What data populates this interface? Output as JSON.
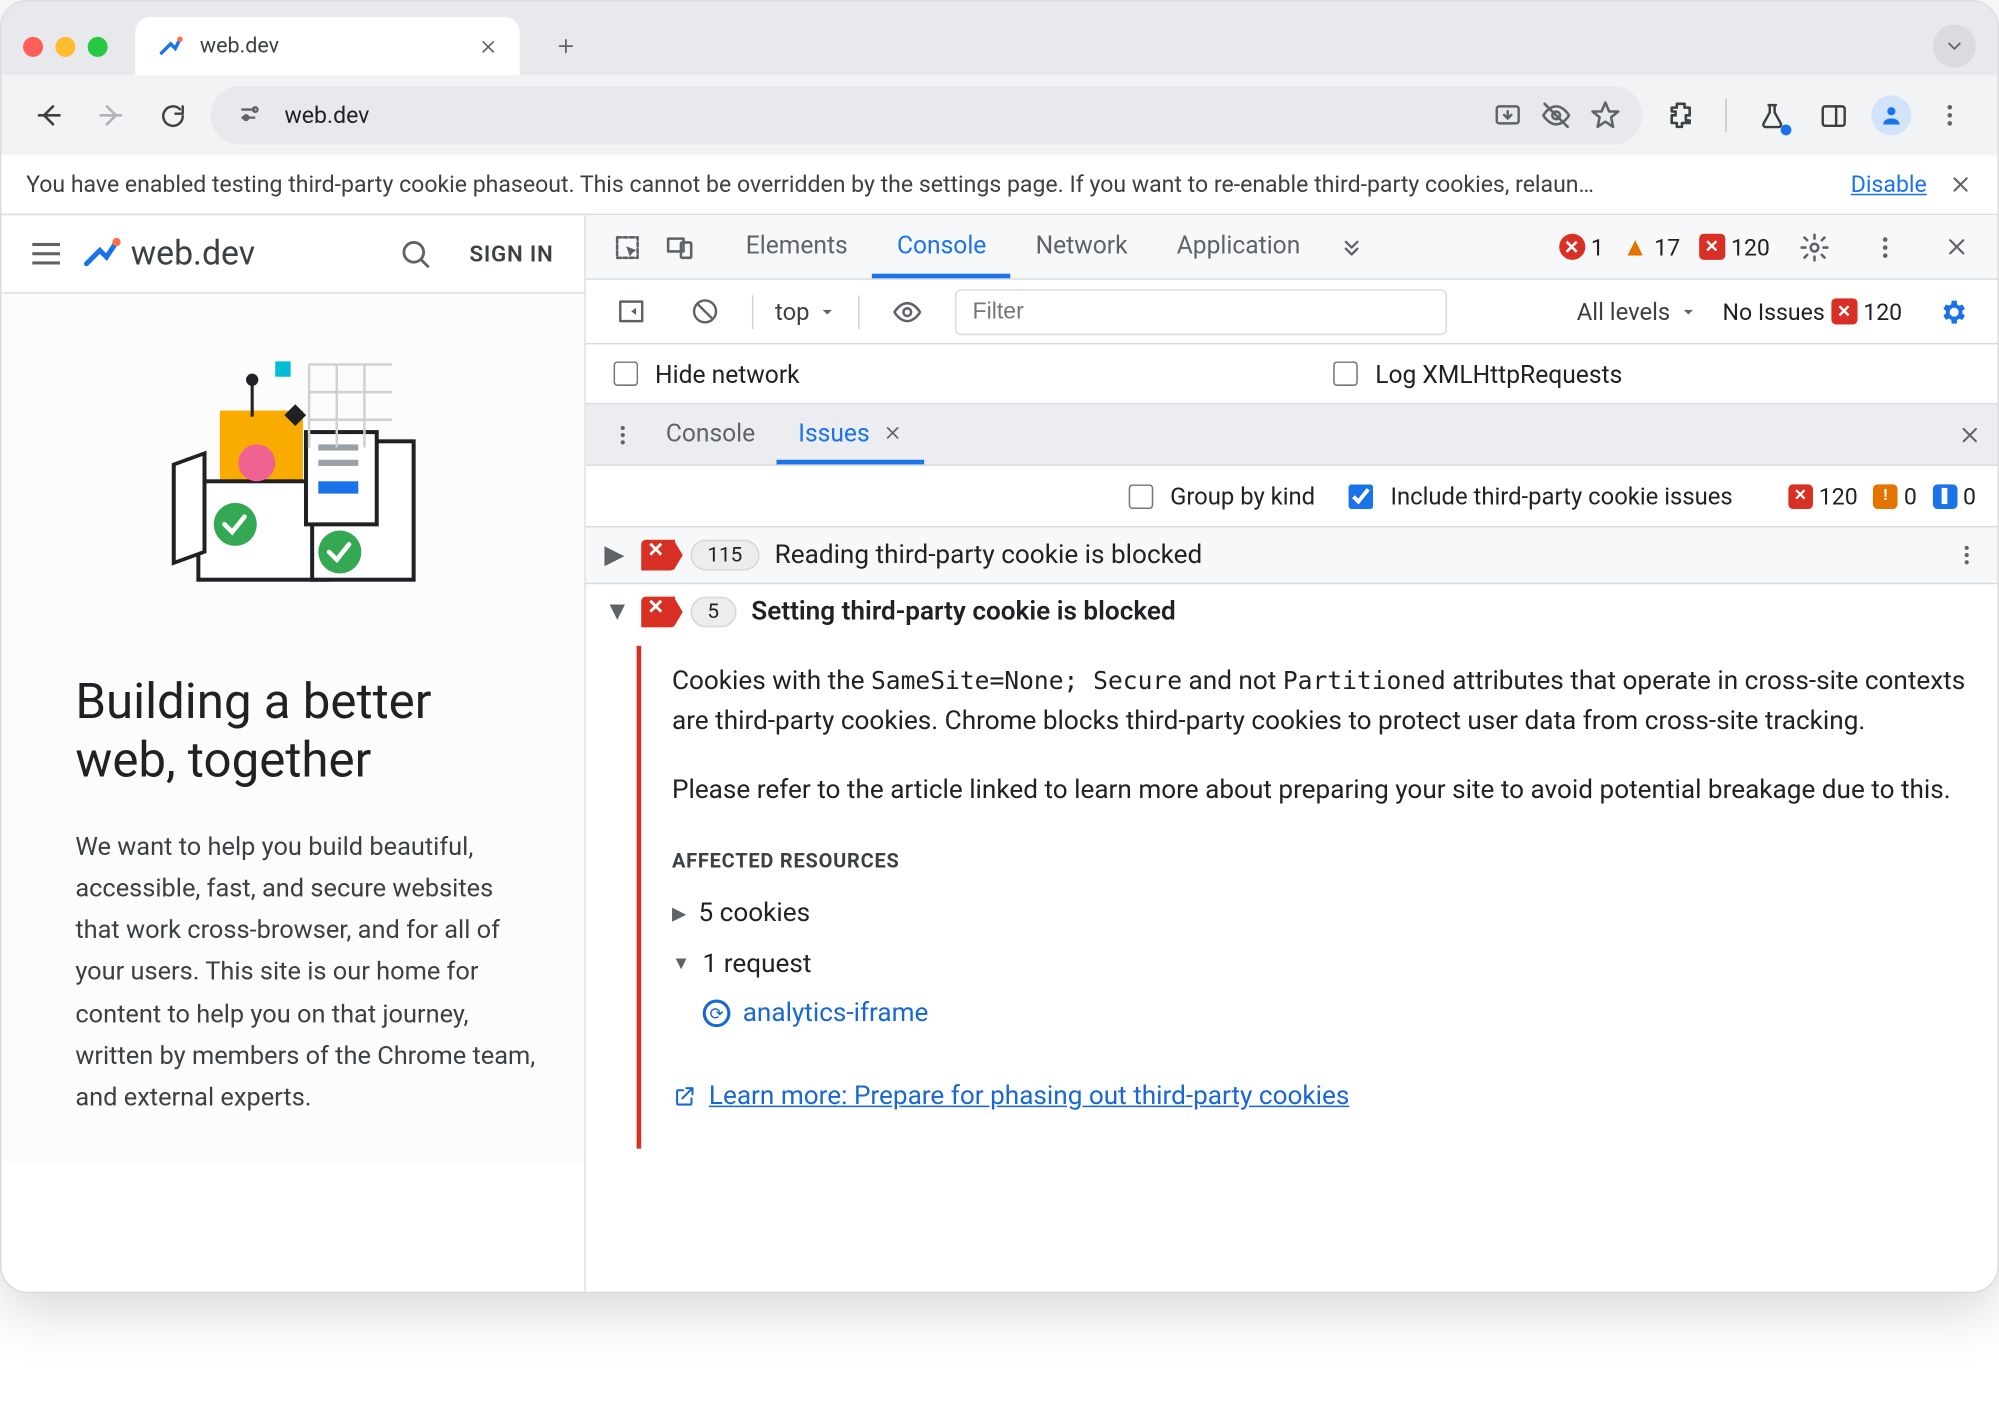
{
  "browser_tab": {
    "title": "web.dev"
  },
  "omnibox": {
    "url": "web.dev"
  },
  "banner": {
    "text": "You have enabled testing third-party cookie phaseout. This cannot be overridden by the settings page. If you want to re-enable third-party cookies, relaun…",
    "action": "Disable"
  },
  "page": {
    "brand": "web.dev",
    "sign_in": "SIGN IN",
    "hero_title": "Building a better web, together",
    "hero_body": "We want to help you build beautiful, accessible, fast, and secure websites that work cross-browser, and for all of your users. This site is our home for content to help you on that journey, written by members of the Chrome team, and external experts."
  },
  "devtools": {
    "tabs": {
      "elements": "Elements",
      "console": "Console",
      "network": "Network",
      "application": "Application"
    },
    "counts": {
      "errors": 1,
      "warnings": 17,
      "blocked": 120
    },
    "filter": {
      "context": "top",
      "placeholder": "Filter",
      "levels": "All levels",
      "issues": "No Issues",
      "issues_count": 120
    },
    "checks": {
      "hide_network": "Hide network",
      "log_xhr": "Log XMLHttpRequests"
    },
    "drawer": {
      "console": "Console",
      "issues": "Issues"
    },
    "issues_bar": {
      "group": "Group by kind",
      "include": "Include third-party cookie issues",
      "red": 120,
      "orange": 0,
      "blue": 0
    },
    "issue1": {
      "count": 115,
      "title": "Reading third-party cookie is blocked"
    },
    "issue2": {
      "count": 5,
      "title": "Setting third-party cookie is blocked",
      "p1a": "Cookies with the ",
      "p1b": "SameSite=None; Secure",
      "p1c": " and not ",
      "p1d": "Partitioned",
      "p1e": " attributes that operate in cross-site contexts are third-party cookies. Chrome blocks third-party cookies to protect user data from cross-site tracking.",
      "p2": "Please refer to the article linked to learn more about preparing your site to avoid potential breakage due to this.",
      "affected_label": "AFFECTED RESOURCES",
      "cookies": "5 cookies",
      "requests": "1 request",
      "req_name": "analytics-iframe",
      "learn_more": "Learn more: Prepare for phasing out third-party cookies"
    }
  }
}
